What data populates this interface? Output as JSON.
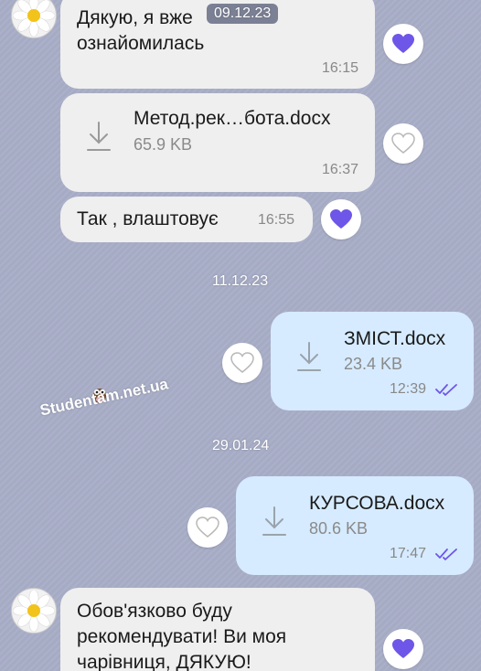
{
  "colors": {
    "background": "#a9aec8",
    "incoming_bubble": "#efefef",
    "outgoing_bubble": "#d6ebff",
    "heart_active": "#6e56e8",
    "read_ticks": "#6e56e8"
  },
  "date_overlay": "09.12.23",
  "messages": [
    {
      "type": "text",
      "direction": "in",
      "lines": [
        "Дякую, я вже",
        "ознайомилась"
      ],
      "time": "16:15",
      "liked": true
    },
    {
      "type": "file",
      "direction": "in",
      "filename": "Метод.рек…бота.docx",
      "size": "65.9 KB",
      "time": "16:37",
      "liked": false
    },
    {
      "type": "text",
      "direction": "in",
      "text": "Так , влаштовує",
      "time": "16:55",
      "liked": true
    }
  ],
  "date_sep_1": "11.12.23",
  "out_file_1": {
    "filename": "ЗМІСТ.docx",
    "size": "23.4 KB",
    "time": "12:39",
    "status": "read",
    "liked": false
  },
  "watermark": "Studentam.net.ua",
  "date_sep_2": "29.01.24",
  "out_file_2": {
    "filename": "КУРСОВА.docx",
    "size": "80.6 KB",
    "time": "17:47",
    "status": "read",
    "liked": false
  },
  "last_message": {
    "lines": [
      "Обов'язково буду",
      "рекомендувати! Ви моя",
      "чарівниця, ДЯКУЮ!"
    ],
    "liked": true
  },
  "icons": {
    "avatar": "daisy-avatar-icon",
    "heart_filled": "heart-filled-icon",
    "heart_outline": "heart-outline-icon",
    "download": "download-icon",
    "read": "double-check-icon"
  }
}
